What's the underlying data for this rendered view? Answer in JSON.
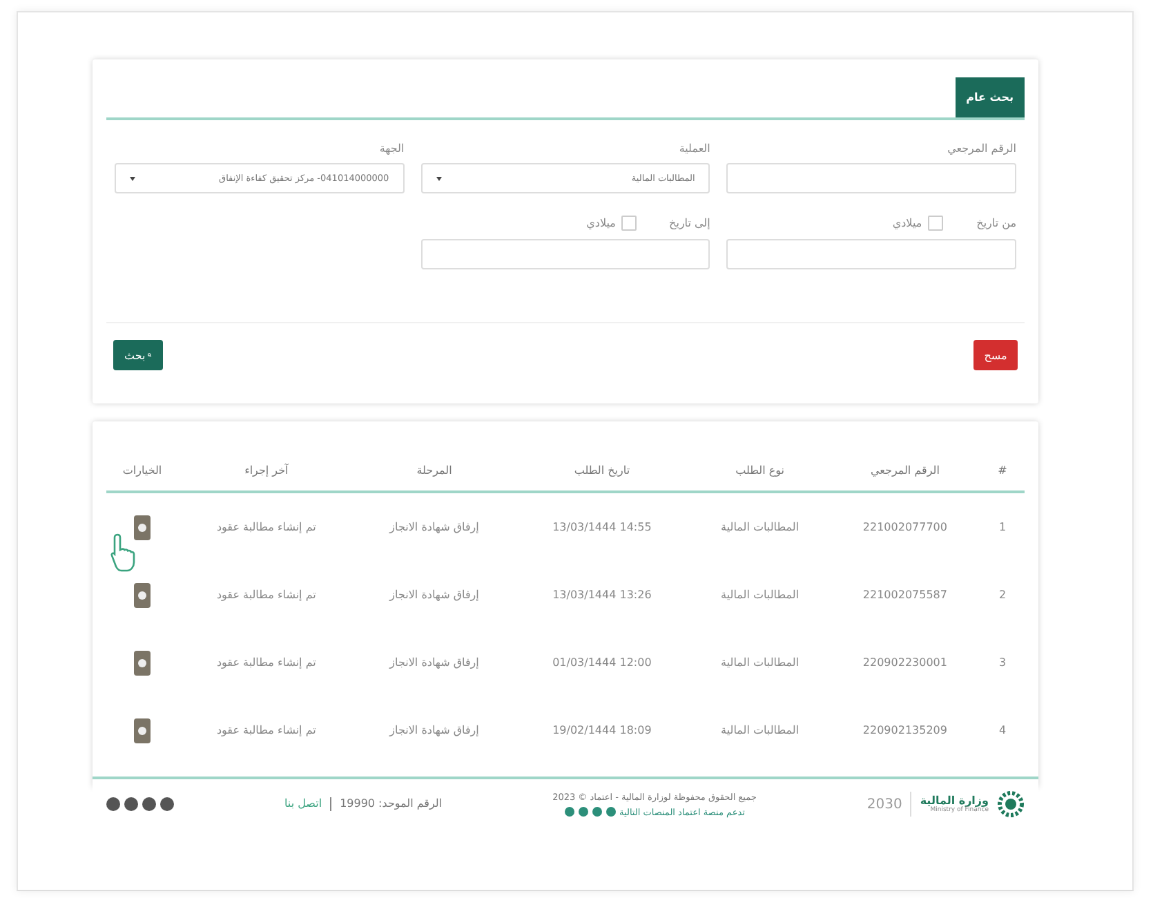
{
  "search_panel": {
    "tab": {
      "label": "بحث عام",
      "selected": true
    },
    "fields": [
      {
        "kind": "text",
        "label": "الرقم المرجعي"
      },
      {
        "kind": "select",
        "label": "العملية",
        "value": "المطالبات المالية"
      },
      {
        "kind": "select",
        "label": "الجهة",
        "value": "041014000000- مركز تحقيق كفاءة الإنفاق"
      },
      {
        "kind": "date",
        "label": "من تاريخ",
        "checkbox_label": "ميلادي",
        "checked": false
      },
      {
        "kind": "date",
        "label": "إلى تاريخ",
        "checkbox_label": "ميلادي",
        "checked": false
      }
    ],
    "clear_button": "مسح",
    "search_button": "بحث"
  },
  "table": {
    "columns": [
      "#",
      "الرقم المرجعي",
      "نوع الطلب",
      "تاريخ الطلب",
      "المرحلة",
      "آخر إجراء",
      "الخيارات"
    ],
    "rows": [
      {
        "index": "1",
        "reference": "221002077700",
        "type": "المطالبات المالية",
        "date": "14:55 13/03/1444",
        "stage": "إرفاق شهادة الانجاز",
        "last_action": "تم إنشاء مطالبة عقود"
      },
      {
        "index": "2",
        "reference": "221002075587",
        "type": "المطالبات المالية",
        "date": "13:26 13/03/1444",
        "stage": "إرفاق شهادة الانجاز",
        "last_action": "تم إنشاء مطالبة عقود"
      },
      {
        "index": "3",
        "reference": "220902230001",
        "type": "المطالبات المالية",
        "date": "12:00 01/03/1444",
        "stage": "إرفاق شهادة الانجاز",
        "last_action": "تم إنشاء مطالبة عقود"
      },
      {
        "index": "4",
        "reference": "220902135209",
        "type": "المطالبات المالية",
        "date": "18:09 19/02/1444",
        "stage": "إرفاق شهادة الانجاز",
        "last_action": "تم إنشاء مطالبة عقود"
      }
    ]
  },
  "footer": {
    "ministry_name": "وزارة المالية",
    "ministry_english": "Ministry of Finance",
    "vision": "2030",
    "copyright": "جميع الحقوق محفوظة لوزارة المالية - اعتماد © 2023",
    "platforms_note": "تدعم منصة اعتماد المنصات التالية",
    "unified_number": "الرقم الموحد: 19990",
    "contact_link": "اتصل بنا"
  }
}
